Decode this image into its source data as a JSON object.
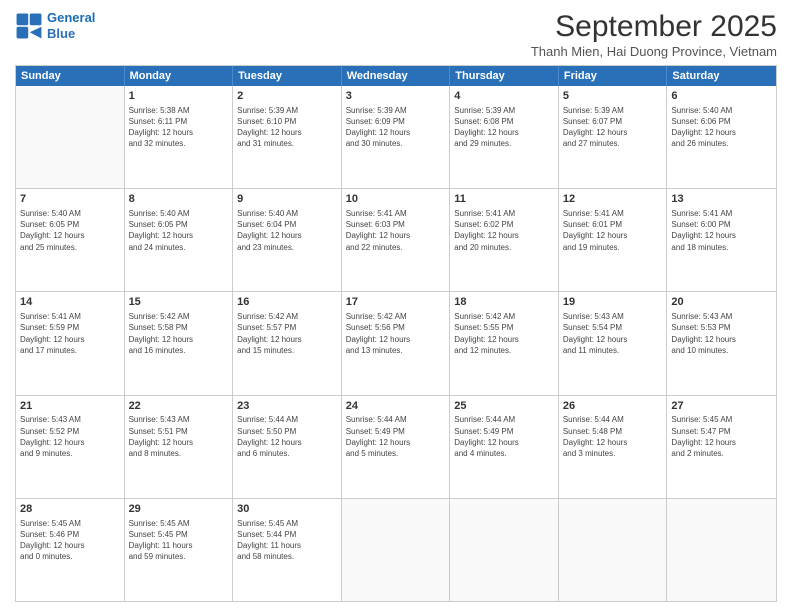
{
  "logo": {
    "line1": "General",
    "line2": "Blue"
  },
  "title": "September 2025",
  "location": "Thanh Mien, Hai Duong Province, Vietnam",
  "header_days": [
    "Sunday",
    "Monday",
    "Tuesday",
    "Wednesday",
    "Thursday",
    "Friday",
    "Saturday"
  ],
  "weeks": [
    [
      {
        "day": "",
        "info": ""
      },
      {
        "day": "1",
        "info": "Sunrise: 5:38 AM\nSunset: 6:11 PM\nDaylight: 12 hours\nand 32 minutes."
      },
      {
        "day": "2",
        "info": "Sunrise: 5:39 AM\nSunset: 6:10 PM\nDaylight: 12 hours\nand 31 minutes."
      },
      {
        "day": "3",
        "info": "Sunrise: 5:39 AM\nSunset: 6:09 PM\nDaylight: 12 hours\nand 30 minutes."
      },
      {
        "day": "4",
        "info": "Sunrise: 5:39 AM\nSunset: 6:08 PM\nDaylight: 12 hours\nand 29 minutes."
      },
      {
        "day": "5",
        "info": "Sunrise: 5:39 AM\nSunset: 6:07 PM\nDaylight: 12 hours\nand 27 minutes."
      },
      {
        "day": "6",
        "info": "Sunrise: 5:40 AM\nSunset: 6:06 PM\nDaylight: 12 hours\nand 26 minutes."
      }
    ],
    [
      {
        "day": "7",
        "info": "Sunrise: 5:40 AM\nSunset: 6:05 PM\nDaylight: 12 hours\nand 25 minutes."
      },
      {
        "day": "8",
        "info": "Sunrise: 5:40 AM\nSunset: 6:05 PM\nDaylight: 12 hours\nand 24 minutes."
      },
      {
        "day": "9",
        "info": "Sunrise: 5:40 AM\nSunset: 6:04 PM\nDaylight: 12 hours\nand 23 minutes."
      },
      {
        "day": "10",
        "info": "Sunrise: 5:41 AM\nSunset: 6:03 PM\nDaylight: 12 hours\nand 22 minutes."
      },
      {
        "day": "11",
        "info": "Sunrise: 5:41 AM\nSunset: 6:02 PM\nDaylight: 12 hours\nand 20 minutes."
      },
      {
        "day": "12",
        "info": "Sunrise: 5:41 AM\nSunset: 6:01 PM\nDaylight: 12 hours\nand 19 minutes."
      },
      {
        "day": "13",
        "info": "Sunrise: 5:41 AM\nSunset: 6:00 PM\nDaylight: 12 hours\nand 18 minutes."
      }
    ],
    [
      {
        "day": "14",
        "info": "Sunrise: 5:41 AM\nSunset: 5:59 PM\nDaylight: 12 hours\nand 17 minutes."
      },
      {
        "day": "15",
        "info": "Sunrise: 5:42 AM\nSunset: 5:58 PM\nDaylight: 12 hours\nand 16 minutes."
      },
      {
        "day": "16",
        "info": "Sunrise: 5:42 AM\nSunset: 5:57 PM\nDaylight: 12 hours\nand 15 minutes."
      },
      {
        "day": "17",
        "info": "Sunrise: 5:42 AM\nSunset: 5:56 PM\nDaylight: 12 hours\nand 13 minutes."
      },
      {
        "day": "18",
        "info": "Sunrise: 5:42 AM\nSunset: 5:55 PM\nDaylight: 12 hours\nand 12 minutes."
      },
      {
        "day": "19",
        "info": "Sunrise: 5:43 AM\nSunset: 5:54 PM\nDaylight: 12 hours\nand 11 minutes."
      },
      {
        "day": "20",
        "info": "Sunrise: 5:43 AM\nSunset: 5:53 PM\nDaylight: 12 hours\nand 10 minutes."
      }
    ],
    [
      {
        "day": "21",
        "info": "Sunrise: 5:43 AM\nSunset: 5:52 PM\nDaylight: 12 hours\nand 9 minutes."
      },
      {
        "day": "22",
        "info": "Sunrise: 5:43 AM\nSunset: 5:51 PM\nDaylight: 12 hours\nand 8 minutes."
      },
      {
        "day": "23",
        "info": "Sunrise: 5:44 AM\nSunset: 5:50 PM\nDaylight: 12 hours\nand 6 minutes."
      },
      {
        "day": "24",
        "info": "Sunrise: 5:44 AM\nSunset: 5:49 PM\nDaylight: 12 hours\nand 5 minutes."
      },
      {
        "day": "25",
        "info": "Sunrise: 5:44 AM\nSunset: 5:49 PM\nDaylight: 12 hours\nand 4 minutes."
      },
      {
        "day": "26",
        "info": "Sunrise: 5:44 AM\nSunset: 5:48 PM\nDaylight: 12 hours\nand 3 minutes."
      },
      {
        "day": "27",
        "info": "Sunrise: 5:45 AM\nSunset: 5:47 PM\nDaylight: 12 hours\nand 2 minutes."
      }
    ],
    [
      {
        "day": "28",
        "info": "Sunrise: 5:45 AM\nSunset: 5:46 PM\nDaylight: 12 hours\nand 0 minutes."
      },
      {
        "day": "29",
        "info": "Sunrise: 5:45 AM\nSunset: 5:45 PM\nDaylight: 11 hours\nand 59 minutes."
      },
      {
        "day": "30",
        "info": "Sunrise: 5:45 AM\nSunset: 5:44 PM\nDaylight: 11 hours\nand 58 minutes."
      },
      {
        "day": "",
        "info": ""
      },
      {
        "day": "",
        "info": ""
      },
      {
        "day": "",
        "info": ""
      },
      {
        "day": "",
        "info": ""
      }
    ]
  ]
}
